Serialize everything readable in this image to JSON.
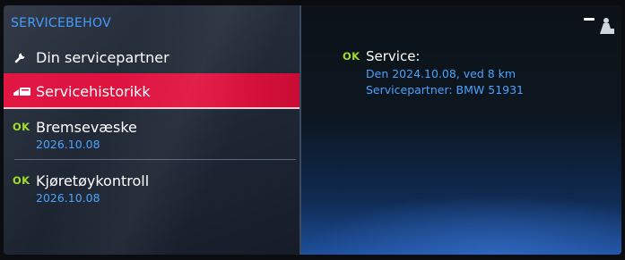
{
  "left_panel": {
    "section_title": "SERVICEBEHOV",
    "items": [
      {
        "label": "Din servicepartner",
        "icon": "wrench-icon"
      },
      {
        "label": "Servicehistorikk",
        "icon": "service-book-icon",
        "selected": true
      },
      {
        "status": "OK",
        "label": "Bremsevæske",
        "date": "2026.10.08"
      },
      {
        "status": "OK",
        "label": "Kjøretøykontroll",
        "date": "2026.10.08"
      }
    ]
  },
  "detail": {
    "status": "OK",
    "title": "Service:",
    "line1": "Den 2024.10.08, ved 8 km",
    "line2": "Servicepartner: BMW 51931"
  },
  "top_right_icon": "seat-profile-icon",
  "colors": {
    "accent_blue": "#4aa3ff",
    "selection_red": "#e0103e",
    "ok_green": "#9fdd2a"
  }
}
